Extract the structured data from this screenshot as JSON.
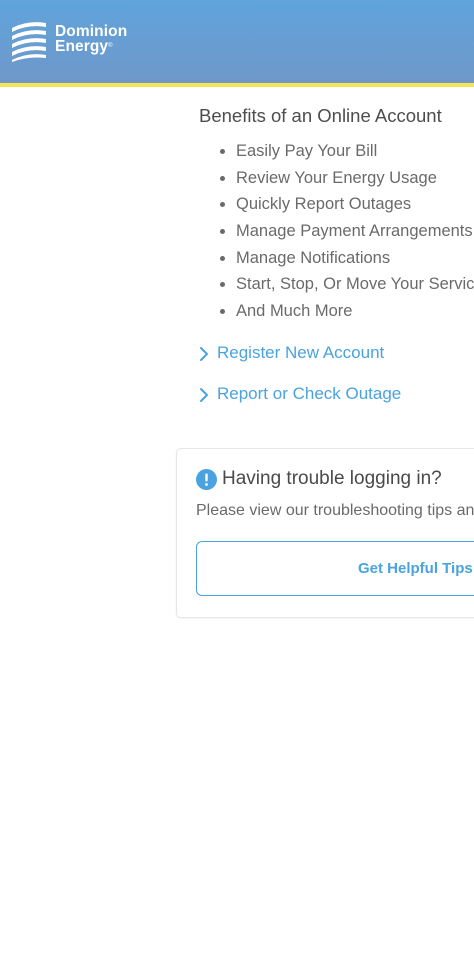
{
  "header": {
    "logo_line1": "Dominion",
    "logo_line2": "Energy",
    "logo_mark": "®",
    "logo_icon": "dominion-stripes-icon",
    "colors": {
      "bar": "#5fa4dc",
      "stripe": "#f5e35a"
    }
  },
  "benefits": {
    "title": "Benefits of an Online Account",
    "items": [
      "Easily Pay Your Bill",
      "Review Your Energy Usage",
      "Quickly Report Outages",
      "Manage Payment Arrangements",
      "Manage Notifications",
      "Start, Stop, Or Move Your Service",
      "And Much More"
    ]
  },
  "links": {
    "register": "Register New Account",
    "outage": "Report or Check Outage",
    "icon": "chevron-right-icon",
    "color": "#4aa3df"
  },
  "trouble_card": {
    "icon": "alert-circle-icon",
    "title": "Having trouble logging in?",
    "text": "Please view our troubleshooting tips and",
    "button": "Get Helpful Tips"
  }
}
